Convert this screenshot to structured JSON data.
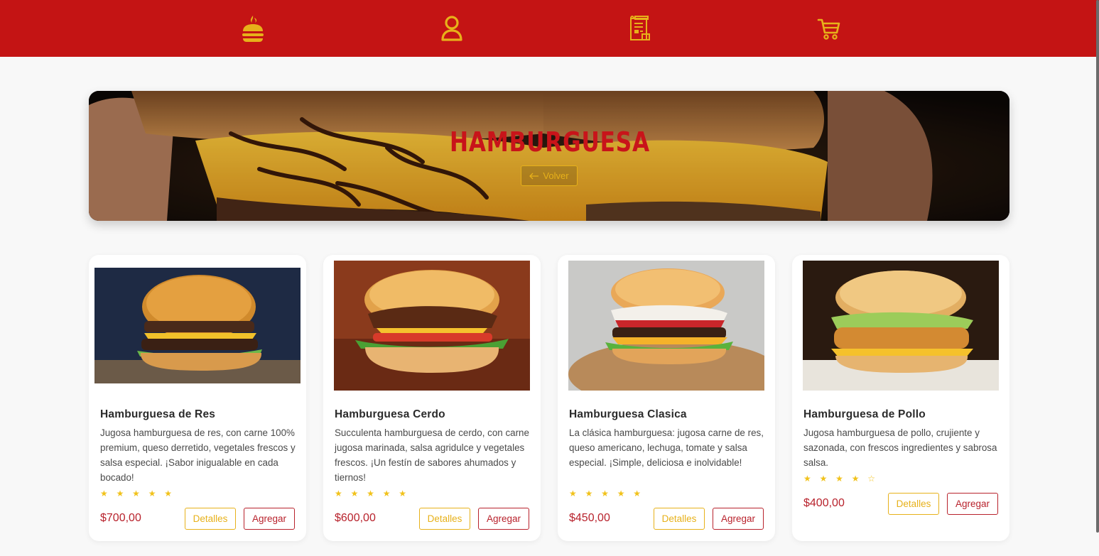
{
  "nav": {
    "icons": [
      "burger-menu-icon",
      "user-icon",
      "receipt-icon",
      "cart-icon"
    ],
    "color": "#e7b11a",
    "background": "#c41414"
  },
  "hero": {
    "title": "HAMBURGUESA",
    "back_label": "Volver"
  },
  "products": [
    {
      "name": "Hamburguesa de Res",
      "description": "Jugosa hamburguesa de res, con carne 100% premium, queso derretido, vegetales frescos y salsa especial. ¡Sabor inigualable en cada bocado!",
      "stars": "★ ★ ★ ★ ★",
      "rating": 5,
      "price": "$700,00",
      "details_label": "Detalles",
      "add_label": "Agregar"
    },
    {
      "name": "Hamburguesa Cerdo",
      "description": "Succulenta hamburguesa de cerdo, con carne jugosa marinada, salsa agridulce y vegetales frescos. ¡Un festín de sabores ahumados y tiernos!",
      "stars": "★ ★ ★ ★ ★",
      "rating": 5,
      "price": "$600,00",
      "details_label": "Detalles",
      "add_label": "Agregar"
    },
    {
      "name": "Hamburguesa Clasica",
      "description": "La clásica hamburguesa: jugosa carne de res, queso americano, lechuga, tomate y salsa especial. ¡Simple, deliciosa e inolvidable!",
      "stars": "★ ★ ★ ★ ★",
      "rating": 5,
      "price": "$450,00",
      "details_label": "Detalles",
      "add_label": "Agregar"
    },
    {
      "name": "Hamburguesa de Pollo",
      "description": "Jugosa hamburguesa de pollo, crujiente y sazonada, con frescos ingredientes y sabrosa salsa.",
      "stars": "★ ★ ★ ★ ☆",
      "rating": 4,
      "price": "$400,00",
      "details_label": "Detalles",
      "add_label": "Agregar"
    }
  ]
}
